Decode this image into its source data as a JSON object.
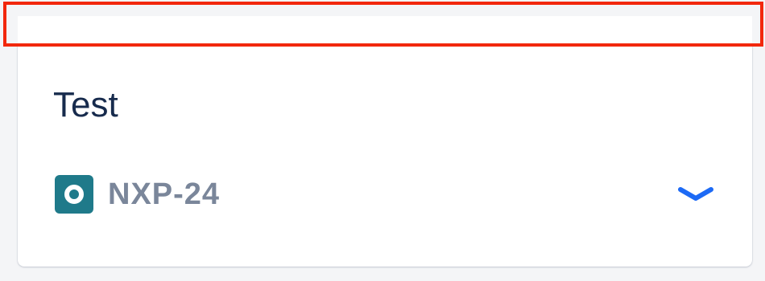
{
  "card": {
    "title": "Test",
    "issue": {
      "key": "NXP-24",
      "type_icon": "issue-type-icon"
    },
    "expand_icon": "chevron-down-icon"
  },
  "colors": {
    "highlight": "#f2280c",
    "title": "#172b4d",
    "issue_key": "#7a869a",
    "issue_icon": "#1f7a8a",
    "chevron": "#1d6af5"
  }
}
